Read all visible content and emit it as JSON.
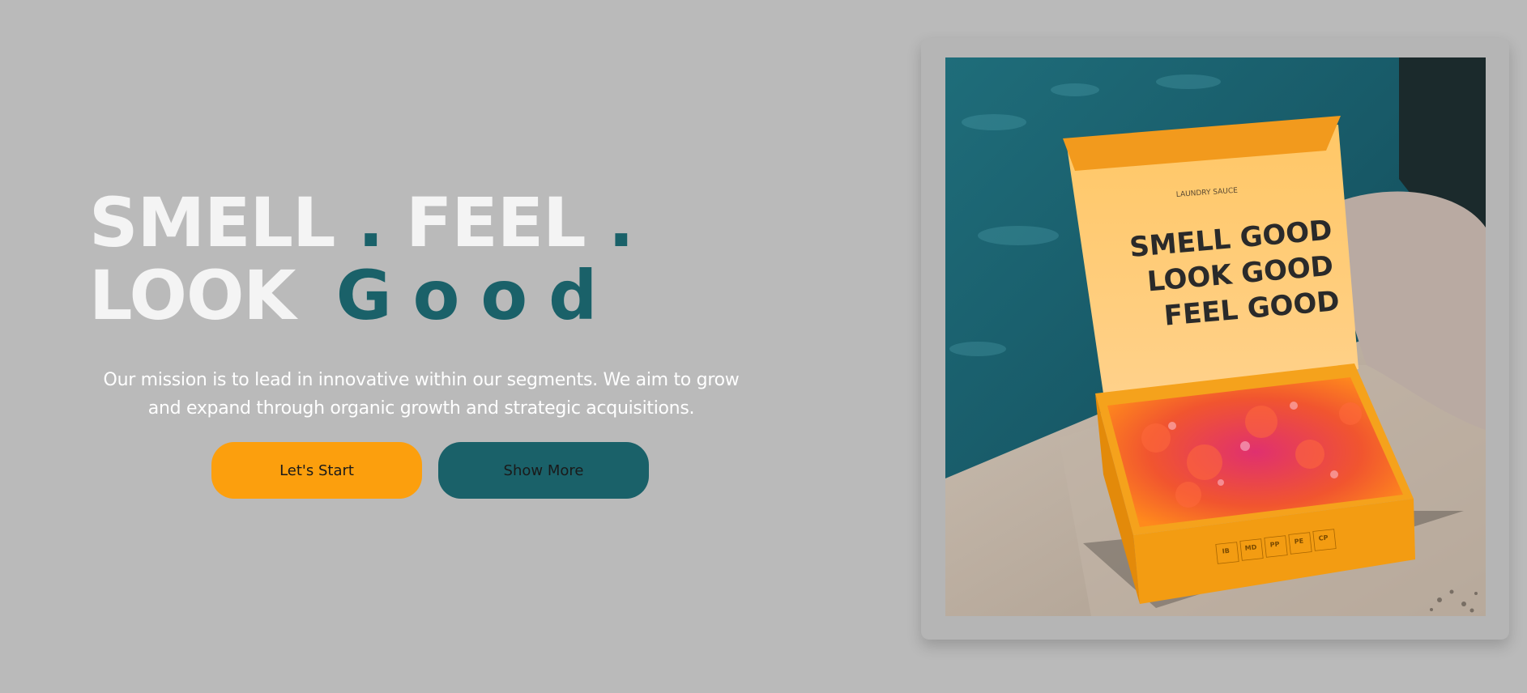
{
  "hero": {
    "headline_line1_a": "SMELL",
    "headline_line1_b": "FEEL",
    "headline_dot": ".",
    "headline_line2_a": "LOOK",
    "headline_line2_b": "Good",
    "mission": "Our mission is to lead in innovative within our segments. We aim to grow and expand through organic growth and strategic acquisitions."
  },
  "buttons": {
    "start_label": "Let's Start",
    "more_label": "Show More"
  },
  "product_image": {
    "brand": "LAUNDRY SAUCE",
    "lid_line1": "SMELL GOOD",
    "lid_line2": "LOOK GOOD",
    "lid_line3": "FEEL GOOD",
    "badges": [
      "IB",
      "MD",
      "PP",
      "PE",
      "CP"
    ]
  },
  "colors": {
    "background": "#bababa",
    "accent_orange": "#fc9f0d",
    "accent_teal": "#1a6169",
    "headline_text": "#f4f4f4"
  }
}
